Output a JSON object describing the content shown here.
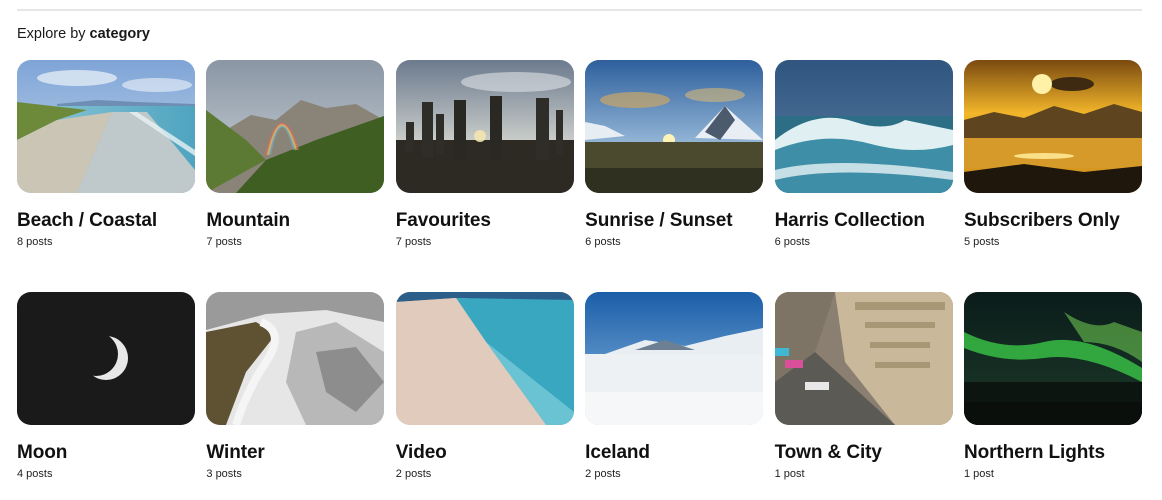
{
  "heading": {
    "prefix": "Explore by",
    "emphasis": "category"
  },
  "categories": [
    {
      "name": "Beach / Coastal",
      "count": "8 posts"
    },
    {
      "name": "Mountain",
      "count": "7 posts"
    },
    {
      "name": "Favourites",
      "count": "7 posts"
    },
    {
      "name": "Sunrise / Sunset",
      "count": "6 posts"
    },
    {
      "name": "Harris Collection",
      "count": "6 posts"
    },
    {
      "name": "Subscribers Only",
      "count": "5 posts"
    },
    {
      "name": "Moon",
      "count": "4 posts"
    },
    {
      "name": "Winter",
      "count": "3 posts"
    },
    {
      "name": "Video",
      "count": "2 posts"
    },
    {
      "name": "Iceland",
      "count": "2 posts"
    },
    {
      "name": "Town & City",
      "count": "1 post"
    },
    {
      "name": "Northern Lights",
      "count": "1 post"
    }
  ]
}
